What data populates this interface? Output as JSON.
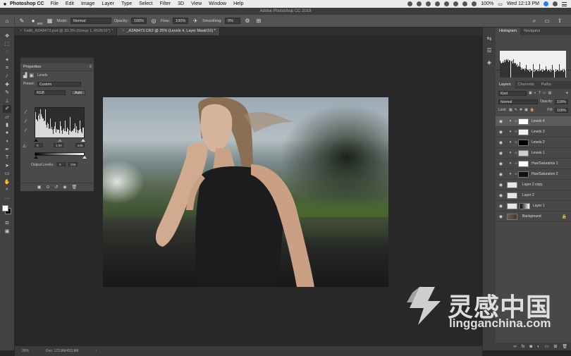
{
  "menubar": {
    "app_name": "Photoshop CC",
    "menus": [
      "File",
      "Edit",
      "Image",
      "Layer",
      "Type",
      "Select",
      "Filter",
      "3D",
      "View",
      "Window",
      "Help"
    ],
    "battery": "100%",
    "clock": "Wed 12:13 PM"
  },
  "window": {
    "title": "Adobe Photoshop CC 2019"
  },
  "options": {
    "brush_size": "800",
    "mode_label": "Mode:",
    "mode_value": "Normal",
    "opacity_label": "Opacity:",
    "opacity_value": "100%",
    "flow_label": "Flow:",
    "flow_value": "100%",
    "smoothing_label": "Smoothing:",
    "smoothing_value": "0%"
  },
  "tabs": [
    {
      "label": "Faith_A2A8473.psd @ 33.3% (Group 1, RGB/16*) *"
    },
    {
      "label": "_A2A8473.CR2 @ 25% (Levels 4, Layer Mask/16) *"
    }
  ],
  "properties": {
    "title": "Properties",
    "panel_type": "Levels",
    "preset_label": "Preset:",
    "preset_value": "Custom",
    "channel_value": "RGB",
    "auto_label": "Auto",
    "input_black": "0",
    "input_gamma": "1.00",
    "input_white": "245",
    "output_label": "Output Levels:",
    "output_black": "0",
    "output_white": "255"
  },
  "right_panel": {
    "top_tabs": [
      "Histogram",
      "Navigator"
    ],
    "layer_tabs": [
      "Layers",
      "Channels",
      "Paths"
    ],
    "kind_value": "Kind",
    "blend_mode": "Normal",
    "opacity_label": "Opacity:",
    "opacity_value": "100%",
    "lock_label": "Lock:",
    "fill_label": "Fill:",
    "fill_value": "100%",
    "layers": [
      {
        "name": "Levels 4",
        "active": true,
        "mask": "#ffffff"
      },
      {
        "name": "Levels 3",
        "active": false,
        "mask": "#f2f2f2"
      },
      {
        "name": "Levels 2",
        "active": false,
        "mask": "#000000"
      },
      {
        "name": "Levels 1",
        "active": false,
        "mask": "#cccccc"
      },
      {
        "name": "Hue/Saturation 1",
        "active": false,
        "mask": "#ffffff"
      },
      {
        "name": "Hue/Saturation 2",
        "active": false,
        "mask": "#111111"
      },
      {
        "name": "Layer 2 copy",
        "active": false,
        "mask": ""
      },
      {
        "name": "Layer 2",
        "active": false,
        "mask": ""
      },
      {
        "name": "Layer 1",
        "active": false,
        "mask": "#888888"
      },
      {
        "name": "Background",
        "active": false,
        "mask": ""
      }
    ]
  },
  "status": {
    "zoom": "25%",
    "doc": "Doc: 172.8M/432.8M"
  },
  "watermark": {
    "cn": "灵感中国",
    "en": "lingganchina.com"
  }
}
